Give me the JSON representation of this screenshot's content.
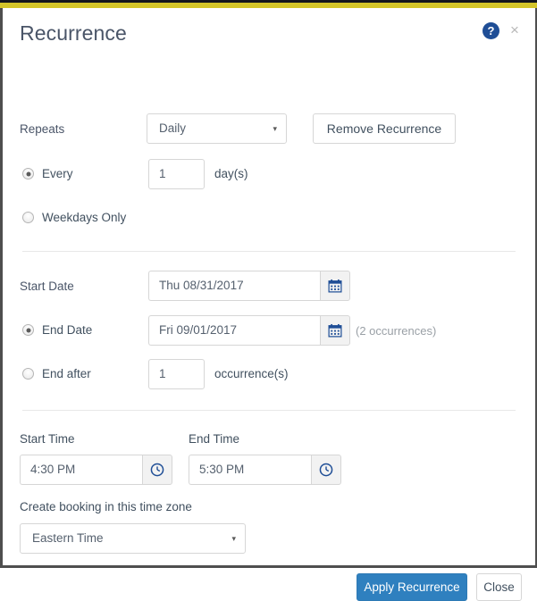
{
  "window": {
    "accent_yellow": "#d4c529",
    "accent_blue": "#2f80bf",
    "icon_blue": "#1f4e96"
  },
  "header": {
    "title": "Recurrence",
    "help_icon": "help-circle-icon",
    "close_icon": "close-icon",
    "close_glyph": "×"
  },
  "repeats": {
    "label": "Repeats",
    "selected": "Daily",
    "caret": "▾",
    "options": [
      "Daily"
    ],
    "remove_button": "Remove Recurrence"
  },
  "frequency": {
    "every_label": "Every",
    "every_selected": true,
    "interval_value": "1",
    "interval_unit": "day(s)",
    "weekdays_label": "Weekdays Only",
    "weekdays_selected": false
  },
  "dates": {
    "start_date_label": "Start Date",
    "start_date_value": "Thu 08/31/2017",
    "start_date_icon": "calendar-icon",
    "end_date_label": "End Date",
    "end_date_selected": true,
    "end_date_value": "Fri 09/01/2017",
    "end_date_icon": "calendar-icon",
    "occurrences_note": "(2 occurrences)",
    "end_after_label": "End after",
    "end_after_selected": false,
    "end_after_value": "1",
    "end_after_unit": "occurrence(s)"
  },
  "times": {
    "start_time_label": "Start Time",
    "start_time_value": "4:30 PM",
    "start_time_icon": "clock-icon",
    "end_time_label": "End Time",
    "end_time_value": "5:30 PM",
    "end_time_icon": "clock-icon"
  },
  "timezone": {
    "label": "Create booking in this time zone",
    "selected": "Eastern Time",
    "caret": "▾",
    "options": [
      "Eastern Time"
    ]
  },
  "footer": {
    "apply_label": "Apply Recurrence",
    "close_label": "Close"
  }
}
